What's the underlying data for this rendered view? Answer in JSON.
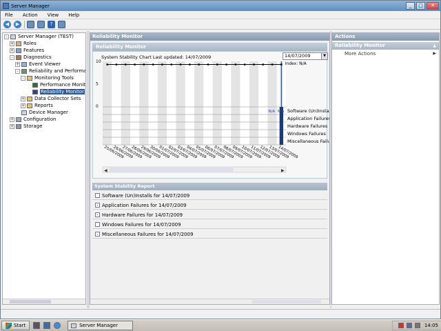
{
  "window": {
    "title": "Server Manager"
  },
  "menu": [
    "File",
    "Action",
    "View",
    "Help"
  ],
  "tree": {
    "items": [
      {
        "label": "Server Manager (TEST)",
        "indent": 0,
        "exp": "-",
        "icon": "server"
      },
      {
        "label": "Roles",
        "indent": 1,
        "exp": "+",
        "icon": "roles"
      },
      {
        "label": "Features",
        "indent": 1,
        "exp": "+",
        "icon": "features"
      },
      {
        "label": "Diagnostics",
        "indent": 1,
        "exp": "-",
        "icon": "diag"
      },
      {
        "label": "Event Viewer",
        "indent": 2,
        "exp": "+",
        "icon": "events"
      },
      {
        "label": "Reliability and Performance",
        "indent": 2,
        "exp": "-",
        "icon": "perf"
      },
      {
        "label": "Monitoring Tools",
        "indent": 3,
        "exp": "-",
        "icon": "folder"
      },
      {
        "label": "Performance Monitor",
        "indent": 4,
        "exp": "",
        "icon": "chart"
      },
      {
        "label": "Reliability Monitor",
        "indent": 4,
        "exp": "",
        "icon": "monitor",
        "selected": true
      },
      {
        "label": "Data Collector Sets",
        "indent": 3,
        "exp": "+",
        "icon": "folder"
      },
      {
        "label": "Reports",
        "indent": 3,
        "exp": "+",
        "icon": "folder"
      },
      {
        "label": "Device Manager",
        "indent": 2,
        "exp": "",
        "icon": "server"
      },
      {
        "label": "Configuration",
        "indent": 1,
        "exp": "+",
        "icon": "config"
      },
      {
        "label": "Storage",
        "indent": 1,
        "exp": "+",
        "icon": "storage"
      }
    ]
  },
  "main": {
    "header": "Reliability Monitor",
    "subheader": "Reliability Monitor",
    "chart_title": "System Stability Chart Last updated: 14/07/2009",
    "date_value": "14/07/2009",
    "index_label": "Index: N/A",
    "report_header": "System Stability Report",
    "report_rows": [
      {
        "label": "Software (Un)Installs for 14/07/2009",
        "exp": ""
      },
      {
        "label": "Application Failures for 14/07/2009",
        "exp": "-"
      },
      {
        "label": "Hardware Failures for 14/07/2009",
        "exp": "-"
      },
      {
        "label": "Windows Failures for 14/07/2009",
        "exp": ""
      },
      {
        "label": "Miscellaneous Failures for 14/07/2009",
        "exp": "-"
      }
    ]
  },
  "chart_data": {
    "type": "line",
    "yticks": [
      "10",
      "5",
      "0"
    ],
    "ylim": [
      0,
      10
    ],
    "x": [
      "25/06/2009",
      "26/06/2009",
      "27/06/2009",
      "28/06/2009",
      "29/06/2009",
      "30/06/2009",
      "01/07/2009",
      "02/07/2009",
      "03/07/2009",
      "04/07/2009",
      "05/07/2009",
      "06/07/2009",
      "07/07/2009",
      "08/07/2009",
      "09/07/2009",
      "10/07/2009",
      "11/07/2009",
      "12/07/2009",
      "13/07/2009",
      "14/07/2009"
    ],
    "series": [
      {
        "values": [
          9.3,
          9.3,
          9.3,
          9.3,
          9.3,
          9.3,
          9.3,
          9.3,
          9.3,
          9.3,
          9.3,
          9.3,
          9.3,
          9.3,
          9.3,
          9.3,
          9.3,
          9.3,
          9.3,
          9.3
        ]
      }
    ],
    "categories": [
      "Software (Un)Installs",
      "Application Failures",
      "Hardware Failures",
      "Windows Failures",
      "Miscellaneous Failures"
    ],
    "na_markers": [
      {
        "category": 0,
        "x_index": 18,
        "label": "N/A"
      },
      {
        "category": 0,
        "x_index": 19,
        "label": "N/A"
      }
    ],
    "selected_index": 19,
    "grid": true
  },
  "actions": {
    "header": "Actions",
    "section": "Reliability Monitor",
    "items": [
      "More Actions"
    ]
  },
  "taskbar": {
    "start": "Start",
    "task": "Server Manager",
    "clock": "14:05"
  }
}
